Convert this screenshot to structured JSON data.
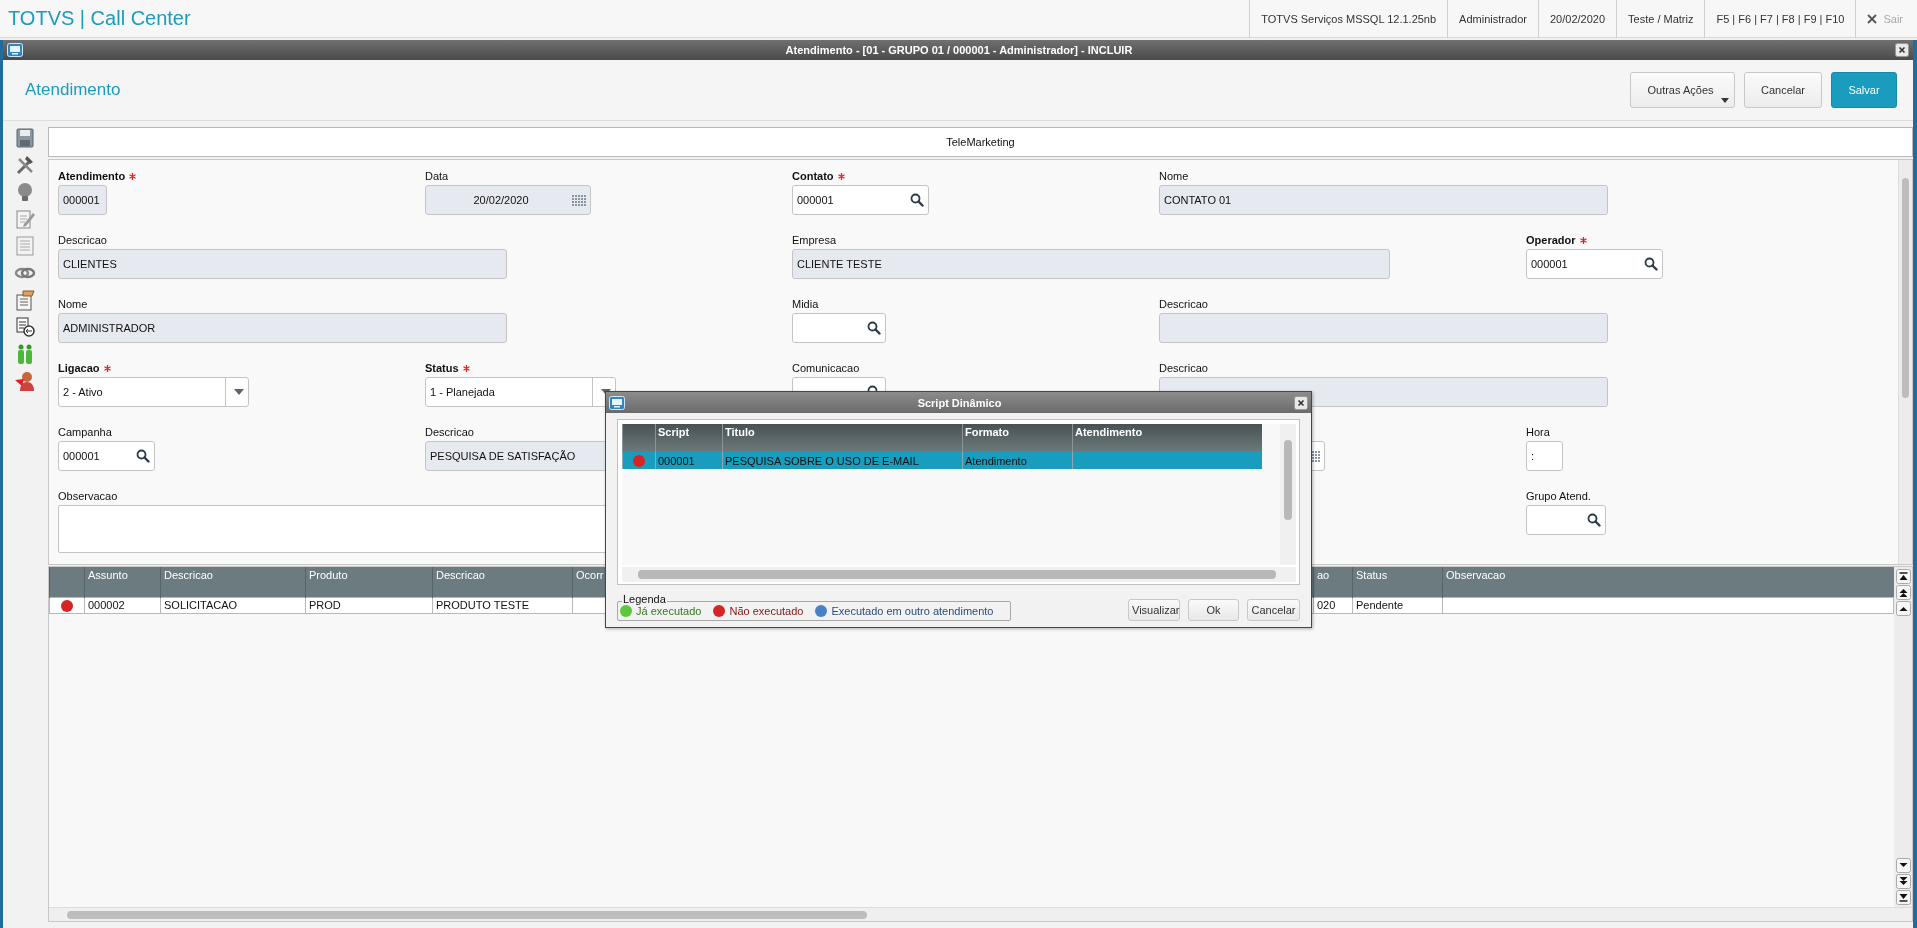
{
  "top_bar": {
    "app_title": "TOTVS | Call Center",
    "info": [
      "TOTVS Serviços MSSQL 12.1.25nb",
      "Administrador",
      "20/02/2020",
      "Teste / Matriz",
      "F5 | F6 | F7 | F8 | F9 | F10"
    ],
    "exit": {
      "label": "Sair",
      "disabled": true
    }
  },
  "window": {
    "title": "Atendimento - [01 - GRUPO 01 / 000001 - Administrador] - INCLUIR"
  },
  "header": {
    "title": "Atendimento",
    "buttons": [
      {
        "label": "Outras Ações",
        "kind": "menu"
      },
      {
        "label": "Cancelar",
        "kind": "default"
      },
      {
        "label": "Salvar",
        "kind": "primary"
      }
    ]
  },
  "tab": {
    "label": "TeleMarketing"
  },
  "fields": [
    {
      "label": "Atendimento",
      "required": true,
      "kind": "text",
      "readonly": true,
      "value": "000001"
    },
    {
      "label": "Data",
      "required": false,
      "kind": "date",
      "readonly": true,
      "value": "20/02/2020"
    },
    {
      "label": "Contato",
      "required": true,
      "kind": "lookup",
      "readonly": false,
      "value": "000001"
    },
    {
      "label": "Nome",
      "required": false,
      "kind": "text",
      "readonly": true,
      "value": "CONTATO 01"
    },
    {
      "label": "Descricao",
      "required": false,
      "kind": "text",
      "readonly": true,
      "value": "CLIENTES"
    },
    {
      "label": "Empresa",
      "required": false,
      "kind": "text",
      "readonly": true,
      "value": "CLIENTE TESTE"
    },
    {
      "label": "Operador",
      "required": true,
      "kind": "lookup",
      "readonly": false,
      "value": "000001"
    },
    {
      "label": "Nome",
      "required": false,
      "kind": "text",
      "readonly": true,
      "value": "ADMINISTRADOR"
    },
    {
      "label": "Midia",
      "required": false,
      "kind": "lookup",
      "readonly": false
    },
    {
      "label": "Descricao",
      "required": false,
      "kind": "text",
      "readonly": true
    },
    {
      "label": "Ligacao",
      "required": true,
      "kind": "combo",
      "readonly": false,
      "value": "2 - Ativo"
    },
    {
      "label": "Status",
      "required": true,
      "kind": "combo",
      "readonly": false,
      "value": "1 - Planejada"
    },
    {
      "label": "Comunicacao",
      "required": false,
      "kind": "lookup",
      "readonly": false
    },
    {
      "label": "Descricao",
      "required": false,
      "kind": "text",
      "readonly": true
    },
    {
      "label": "Campanha",
      "required": false,
      "kind": "lookup",
      "readonly": false,
      "value": "000001"
    },
    {
      "label": "Descricao",
      "required": false,
      "kind": "text",
      "readonly": true,
      "value": "PESQUISA DE SATISFAÇÃO"
    },
    {
      "kind": "date",
      "readonly": false
    },
    {
      "label": "Hora",
      "required": false,
      "kind": "text",
      "readonly": false,
      "value": ":"
    },
    {
      "label": "Observacao",
      "required": false,
      "kind": "memo",
      "readonly": false
    },
    {
      "label": "Grupo Atend.",
      "required": false,
      "kind": "lookup",
      "readonly": false
    }
  ],
  "grid": {
    "columns": [
      "Assunto",
      "Descricao",
      "Produto",
      "Descricao",
      "Ocorr",
      "ao",
      "Status",
      "Observacao"
    ],
    "rows": [
      {
        "color": "#d62424",
        "cells": [
          "000002",
          "SOLICITACAO",
          "PROD",
          "PRODUTO TESTE",
          null,
          "020",
          "Pendente",
          null
        ]
      }
    ]
  },
  "dialog": {
    "title": "Script Dinâmico",
    "columns": [
      "Script",
      "Titulo",
      "Formato",
      "Atendimento"
    ],
    "rows": [
      {
        "color": "#d62424",
        "selected": true,
        "cells": [
          "000001",
          "PESQUISA SOBRE O USO DE E-MAIL",
          "Atendimento",
          null
        ]
      }
    ],
    "legend": {
      "title": "Legenda",
      "items": [
        {
          "label": "Já executado",
          "color": "#5cc83a"
        },
        {
          "label": "Não executado",
          "color": "#d62424"
        },
        {
          "label": "Executado em outro atendimento",
          "color": "#4a80c8"
        }
      ]
    },
    "buttons": [
      "Visualizar",
      "Ok",
      "Cancelar"
    ]
  }
}
